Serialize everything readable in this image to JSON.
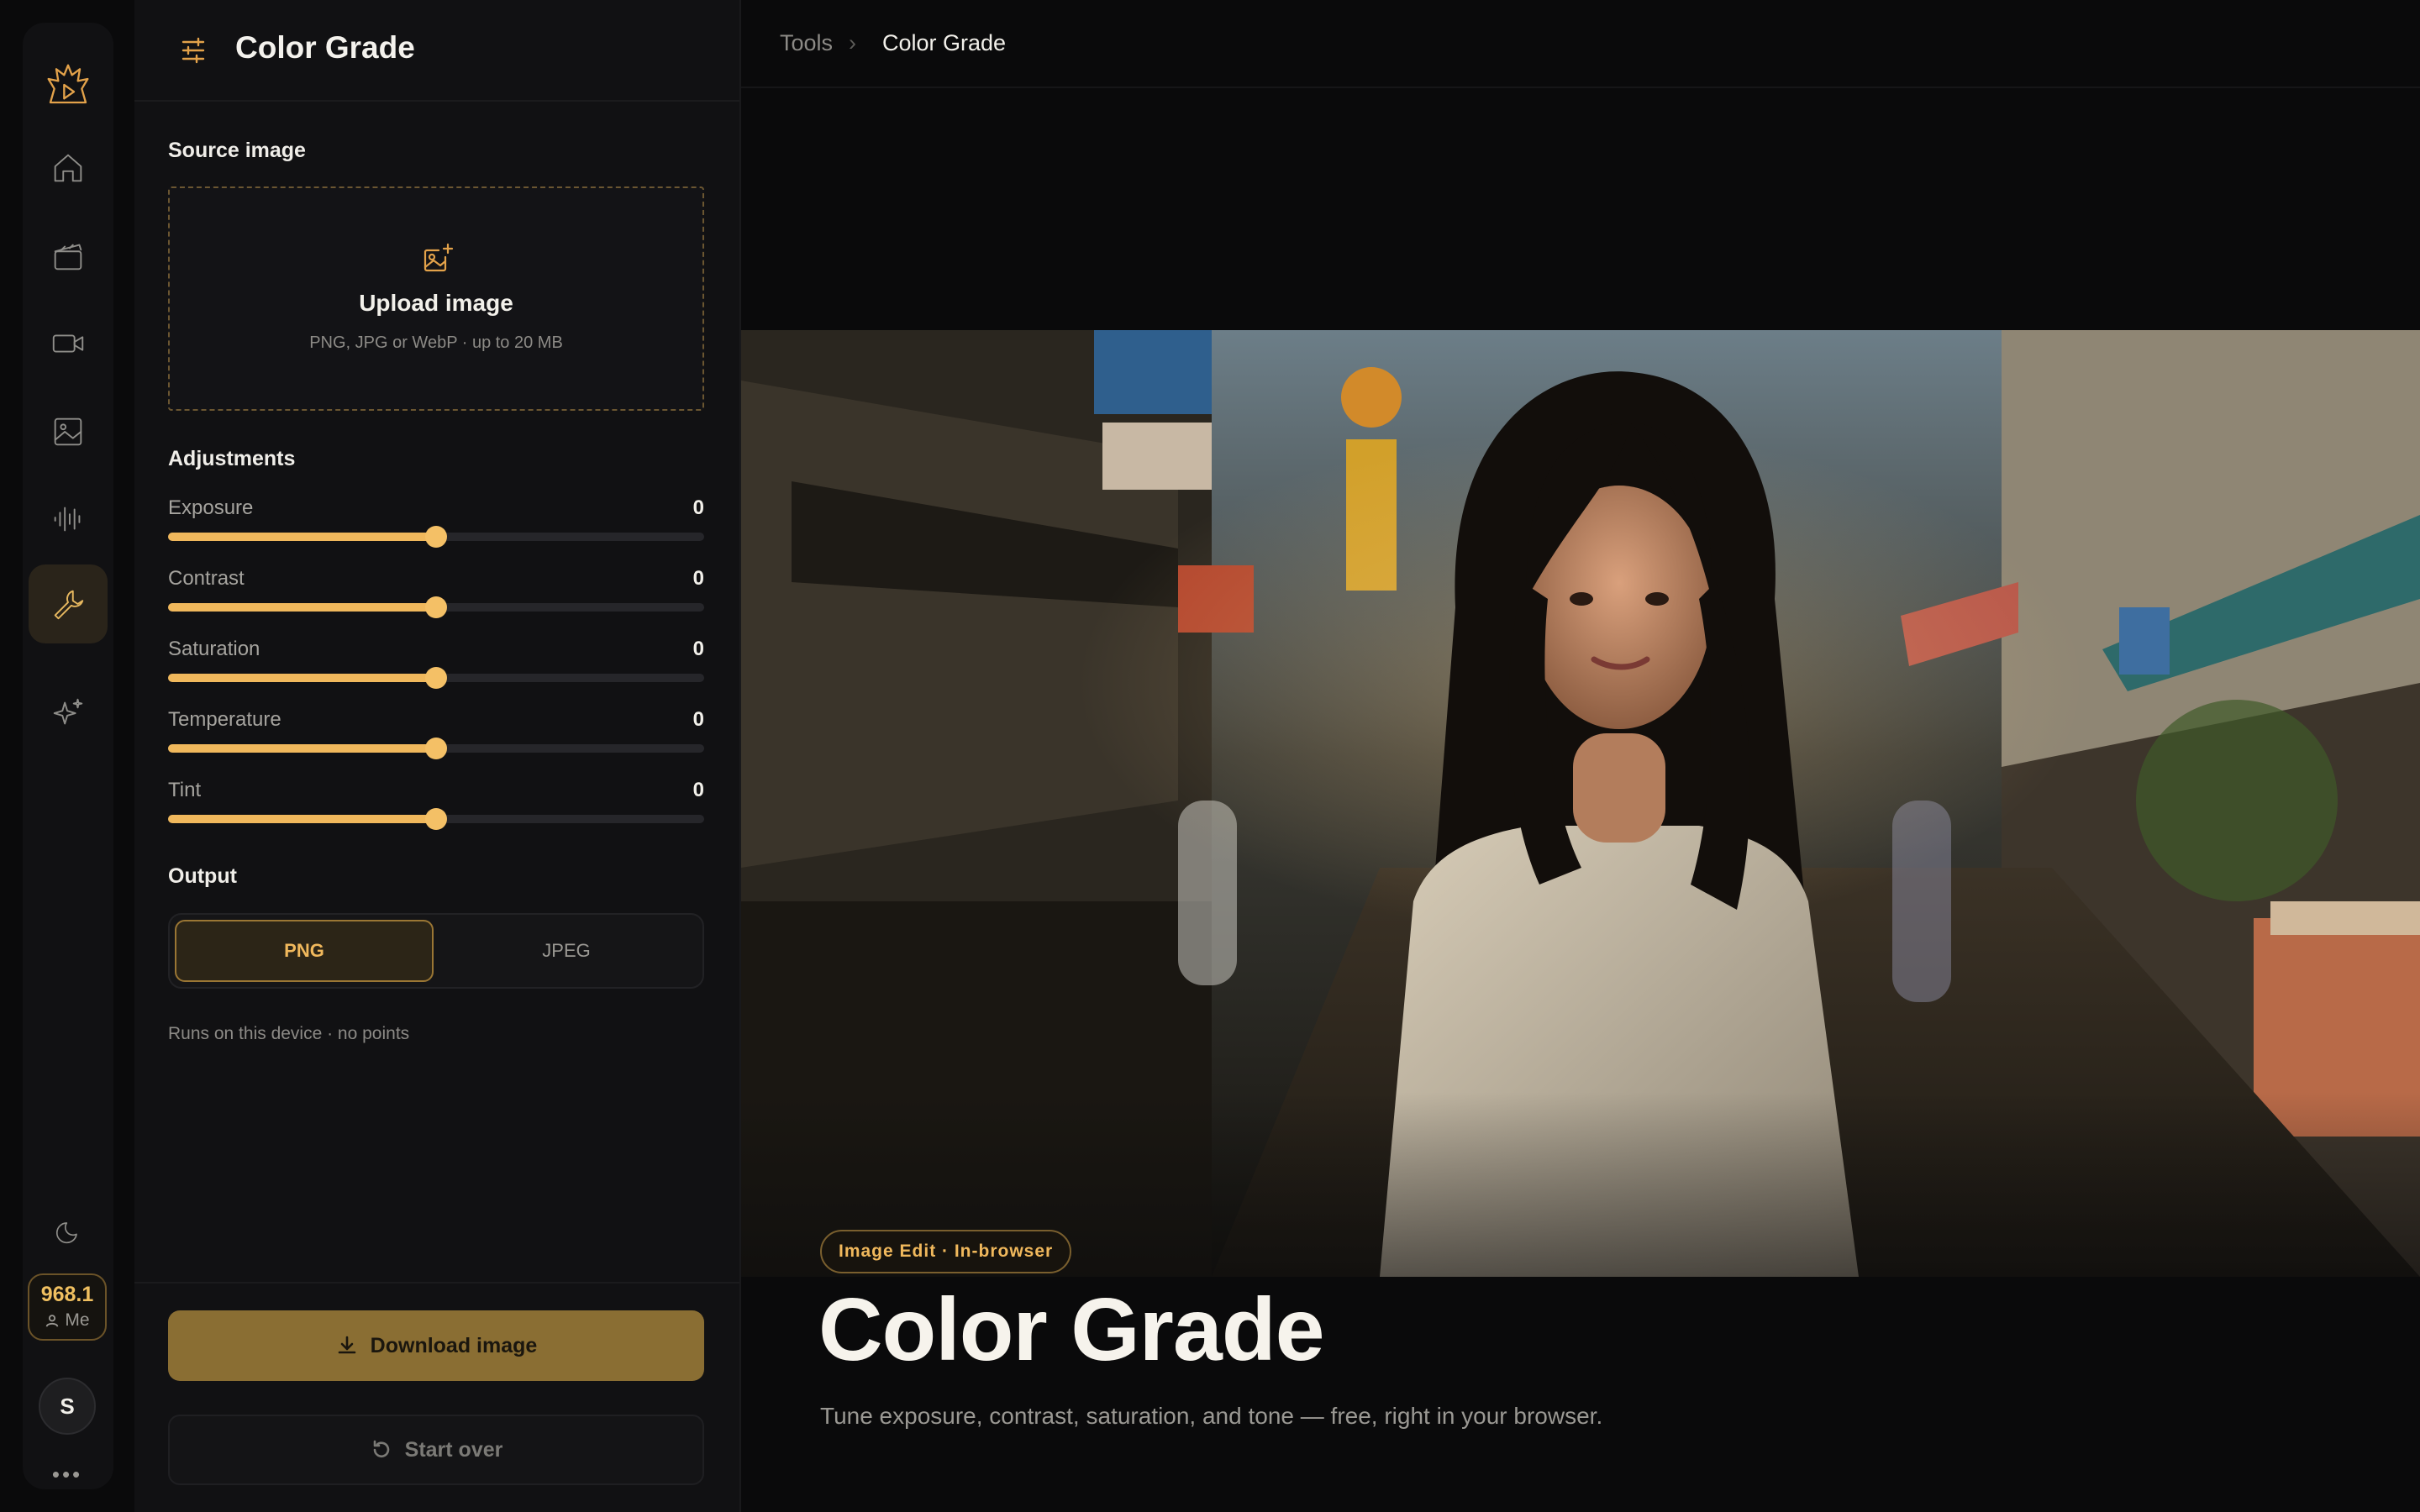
{
  "panel": {
    "title": "Color Grade",
    "source_label": "Source image",
    "upload": {
      "title": "Upload image",
      "subtitle": "PNG, JPG or WebP · up to 20 MB"
    },
    "adjustments_label": "Adjustments",
    "sliders": [
      {
        "label": "Exposure",
        "value": "0",
        "fraction": 0.5
      },
      {
        "label": "Contrast",
        "value": "0",
        "fraction": 0.5
      },
      {
        "label": "Saturation",
        "value": "0",
        "fraction": 0.5
      },
      {
        "label": "Temperature",
        "value": "0",
        "fraction": 0.5
      },
      {
        "label": "Tint",
        "value": "0",
        "fraction": 0.5
      }
    ],
    "output_label": "Output",
    "formats": [
      {
        "label": "PNG",
        "selected": true
      },
      {
        "label": "JPEG",
        "selected": false
      }
    ],
    "note": "Runs on this device · no points",
    "download_label": "Download image",
    "start_over_label": "Start over"
  },
  "rail": {
    "items": [
      "logo-icon",
      "home-icon",
      "clapperboard-icon",
      "video-icon",
      "image-icon",
      "audio-wave-icon",
      "wrench-icon",
      "sparkles-icon"
    ],
    "active": "wrench-icon",
    "theme_icon": "moon-icon",
    "credits": "968.1",
    "account_label": "Me",
    "avatar_initial": "S"
  },
  "breadcrumb": {
    "parent": "Tools",
    "separator": "›",
    "current": "Color Grade"
  },
  "hero": {
    "tag": "Image Edit · In-browser",
    "title": "Color Grade",
    "subtitle": "Tune exposure, contrast, saturation, and tone — free, right in your browser."
  },
  "colors": {
    "accent": "#f0b85c",
    "accent_dark": "#8a6e33",
    "background": "#0a0a0b",
    "panel": "#111113"
  }
}
